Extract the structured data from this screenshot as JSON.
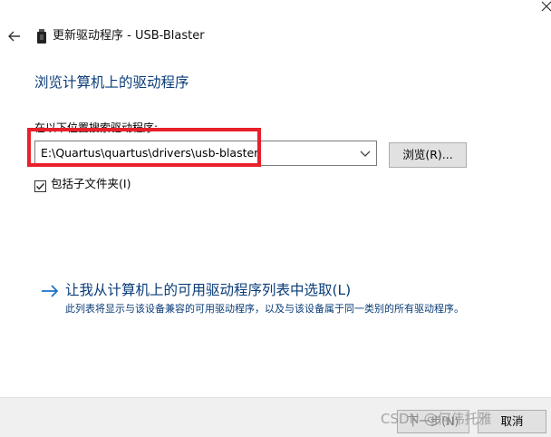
{
  "header": {
    "window_title": "更新驱动程序 - USB-Blaster"
  },
  "main": {
    "heading": "浏览计算机上的驱动程序",
    "location_label": "在以下位置搜索驱动程序:",
    "path_value": "E:\\Quartus\\quartus\\drivers\\usb-blaster",
    "browse_label": "浏览(R)...",
    "include_subfolders": {
      "label": "包括子文件夹(I)",
      "checked": true
    },
    "pick_link": "让我从计算机上的可用驱动程序列表中选取(L)",
    "pick_description": "此列表将显示与该设备兼容的可用驱动程序，以及与该设备属于同一类别的所有驱动程序。"
  },
  "footer": {
    "next_label": "下一步(N)",
    "cancel_label": "取消",
    "watermark": "CSDN @何伟托雅"
  },
  "colors": {
    "heading_blue": "#0a3c78",
    "highlight_red": "#e8202a"
  },
  "icons": {
    "back": "back-arrow-icon",
    "device": "usb-device-icon",
    "dropdown": "chevron-down-icon",
    "link_arrow": "right-arrow-icon"
  }
}
